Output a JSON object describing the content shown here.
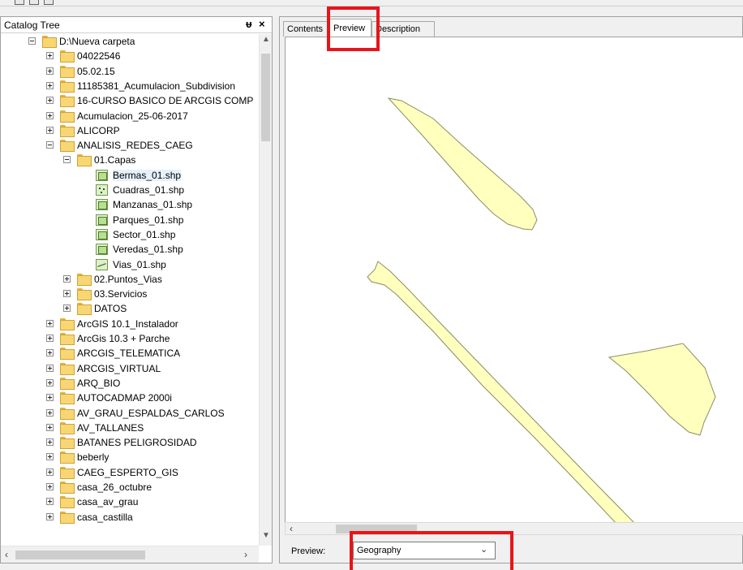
{
  "catalog": {
    "title": "Catalog Tree",
    "pin_glyph": "ᵾ",
    "close_glyph": "×",
    "items": [
      {
        "label": "D:\\Nueva carpeta",
        "icon": "folder-icon",
        "expander": "minus",
        "level": 1
      },
      {
        "label": "04022546",
        "icon": "folder-icon",
        "expander": "plus",
        "level": 2
      },
      {
        "label": "05.02.15",
        "icon": "folder-icon",
        "expander": "plus",
        "level": 2
      },
      {
        "label": "11185381_Acumulacion_Subdivision",
        "icon": "folder-icon",
        "expander": "plus",
        "level": 2
      },
      {
        "label": "16-CURSO BASICO DE ARCGIS COMP",
        "icon": "folder-icon",
        "expander": "plus",
        "level": 2
      },
      {
        "label": "Acumulacion_25-06-2017",
        "icon": "folder-icon",
        "expander": "plus",
        "level": 2
      },
      {
        "label": "ALICORP",
        "icon": "folder-icon",
        "expander": "plus",
        "level": 2
      },
      {
        "label": "ANALISIS_REDES_CAEG",
        "icon": "folder-icon",
        "expander": "minus",
        "level": 2
      },
      {
        "label": "01.Capas",
        "icon": "folder-icon",
        "expander": "minus",
        "level": 3
      },
      {
        "label": "Bermas_01.shp",
        "icon": "polygon-shapefile-icon",
        "expander": "",
        "level": 4,
        "selected": true
      },
      {
        "label": "Cuadras_01.shp",
        "icon": "point-shapefile-icon",
        "expander": "",
        "level": 4
      },
      {
        "label": "Manzanas_01.shp",
        "icon": "polygon-shapefile-icon",
        "expander": "",
        "level": 4
      },
      {
        "label": "Parques_01.shp",
        "icon": "polygon-shapefile-icon",
        "expander": "",
        "level": 4
      },
      {
        "label": "Sector_01.shp",
        "icon": "polygon-shapefile-icon",
        "expander": "",
        "level": 4
      },
      {
        "label": "Veredas_01.shp",
        "icon": "polygon-shapefile-icon",
        "expander": "",
        "level": 4
      },
      {
        "label": "Vias_01.shp",
        "icon": "line-shapefile-icon",
        "expander": "",
        "level": 4
      },
      {
        "label": "02.Puntos_Vias",
        "icon": "folder-icon",
        "expander": "plus",
        "level": 3
      },
      {
        "label": "03.Servicios",
        "icon": "folder-icon",
        "expander": "plus",
        "level": 3
      },
      {
        "label": "DATOS",
        "icon": "folder-icon",
        "expander": "plus",
        "level": 3
      },
      {
        "label": "ArcGIS 10.1_Instalador",
        "icon": "folder-icon",
        "expander": "plus",
        "level": 2
      },
      {
        "label": "ArcGis 10.3 + Parche",
        "icon": "folder-icon",
        "expander": "plus",
        "level": 2
      },
      {
        "label": "ARCGIS_TELEMATICA",
        "icon": "folder-icon",
        "expander": "plus",
        "level": 2
      },
      {
        "label": "ARCGIS_VIRTUAL",
        "icon": "folder-icon",
        "expander": "plus",
        "level": 2
      },
      {
        "label": "ARQ_BIO",
        "icon": "folder-icon",
        "expander": "plus",
        "level": 2
      },
      {
        "label": "AUTOCADMAP 2000i",
        "icon": "folder-icon",
        "expander": "plus",
        "level": 2
      },
      {
        "label": "AV_GRAU_ESPALDAS_CARLOS",
        "icon": "folder-icon",
        "expander": "plus",
        "level": 2
      },
      {
        "label": "AV_TALLANES",
        "icon": "folder-icon",
        "expander": "plus",
        "level": 2
      },
      {
        "label": "BATANES PELIGROSIDAD",
        "icon": "folder-icon",
        "expander": "plus",
        "level": 2
      },
      {
        "label": "beberly",
        "icon": "folder-icon",
        "expander": "plus",
        "level": 2
      },
      {
        "label": "CAEG_ESPERTO_GIS",
        "icon": "folder-icon",
        "expander": "plus",
        "level": 2
      },
      {
        "label": "casa_26_octubre",
        "icon": "folder-icon",
        "expander": "plus",
        "level": 2
      },
      {
        "label": "casa_av_grau",
        "icon": "folder-icon",
        "expander": "plus",
        "level": 2
      },
      {
        "label": "casa_castilla",
        "icon": "folder-icon",
        "expander": "plus",
        "level": 2
      }
    ]
  },
  "content": {
    "tabs": [
      {
        "label": "Contents",
        "active": false
      },
      {
        "label": "Preview",
        "active": true
      },
      {
        "label": "Description",
        "active": false
      }
    ],
    "preview": {
      "label": "Preview:",
      "selected": "Geography"
    },
    "map": {
      "feature_fill": "#ffffbe",
      "feature_stroke": "#8c8c64"
    }
  },
  "colors": {
    "highlight": "#e8141b",
    "selection": "#e5f1fb"
  }
}
